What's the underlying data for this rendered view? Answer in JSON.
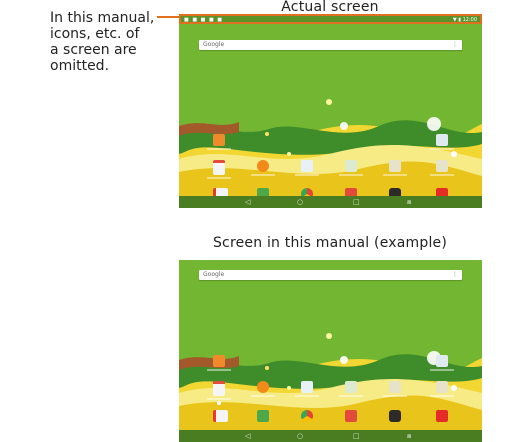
{
  "captions": {
    "actual": "Actual screen",
    "manual": "Screen in this manual (example)"
  },
  "note": {
    "lines": [
      "In this manual,",
      "icons, etc. of",
      "a screen are",
      "omitted."
    ]
  },
  "status_bar": {
    "left_icons": "■ ■ ■ ■ ■",
    "right": "▼ ▮ 12:00"
  },
  "search_bar": {
    "brand": "Google",
    "mic_icon": "mic-icon"
  },
  "navigation": {
    "back": "◁",
    "home": "○",
    "recents": "□",
    "extra": "⧈"
  },
  "colors": {
    "wallpaper": "#73b632",
    "highlight": "#e07020",
    "navbar": "#4a7d22"
  }
}
